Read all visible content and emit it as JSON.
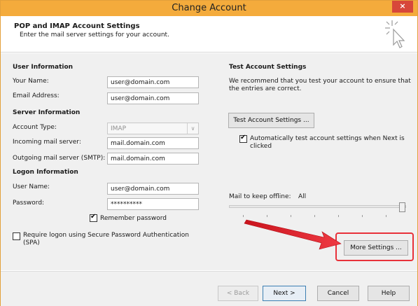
{
  "window": {
    "title": "Change Account",
    "close_label": "×"
  },
  "header": {
    "title": "POP and IMAP Account Settings",
    "subtitle": "Enter the mail server settings for your account.",
    "icon": "cursor-sparkle-icon"
  },
  "user_info": {
    "heading": "User Information",
    "your_name_label": "Your Name:",
    "your_name_value": "user@domain.com",
    "email_label": "Email Address:",
    "email_value": "user@domain.com"
  },
  "server_info": {
    "heading": "Server Information",
    "account_type_label": "Account Type:",
    "account_type_value": "IMAP",
    "incoming_label": "Incoming mail server:",
    "incoming_value": "mail.domain.com",
    "outgoing_label": "Outgoing mail server (SMTP):",
    "outgoing_value": "mail.domain.com"
  },
  "logon_info": {
    "heading": "Logon Information",
    "username_label": "User Name:",
    "username_value": "user@domain.com",
    "password_label": "Password:",
    "password_value": "**********",
    "remember_label": "Remember password",
    "remember_checked": true,
    "spa_label": "Require logon using Secure Password Authentication (SPA)",
    "spa_checked": false
  },
  "test_settings": {
    "heading": "Test Account Settings",
    "description": "We recommend that you test your account to ensure that the entries are correct.",
    "button_label": "Test Account Settings ...",
    "auto_test_label": "Automatically test account settings when Next is clicked",
    "auto_test_checked": true
  },
  "offline": {
    "label": "Mail to keep offline:",
    "value": "All",
    "slider_position": 1.0
  },
  "more_settings_label": "More Settings ...",
  "footer": {
    "back_label": "< Back",
    "next_label": "Next >",
    "cancel_label": "Cancel",
    "help_label": "Help"
  },
  "colors": {
    "titlebar": "#f4ab3c",
    "close": "#d7473a",
    "highlight": "#e8313a",
    "arrow": "#e8242f"
  }
}
